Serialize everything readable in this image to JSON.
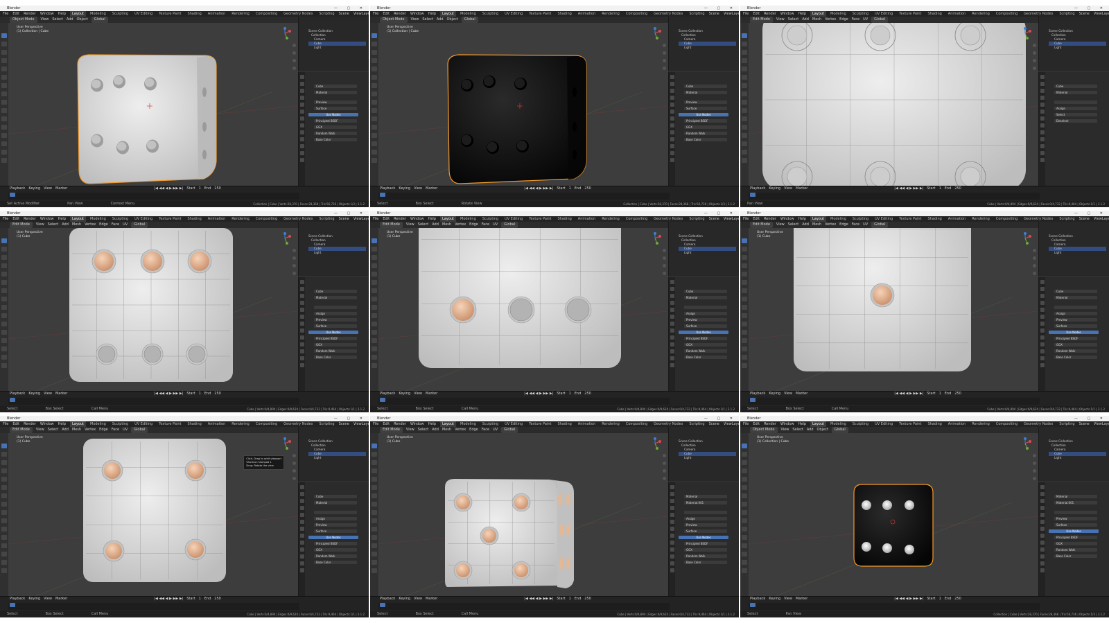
{
  "app": {
    "title": "Blender",
    "window_controls": "— ▢ ✕",
    "menus": [
      "File",
      "Edit",
      "Render",
      "Window",
      "Help"
    ],
    "workspaces": [
      "Layout",
      "Modeling",
      "Sculpting",
      "UV Editing",
      "Texture Paint",
      "Shading",
      "Animation",
      "Rendering",
      "Compositing",
      "Geometry Nodes",
      "Scripting"
    ],
    "active_workspace": "Layout",
    "scene": "Scene",
    "view_layer": "ViewLayer"
  },
  "colors": {
    "viewport_bg": "#3d3d3d",
    "panel_bg": "#2b2b2b",
    "accent_blue": "#4772b3",
    "selection_orange": "#f29a2e",
    "die_white": "#dcdcdc",
    "die_black": "#0b0b0b",
    "pip_skin": "#e7b996"
  },
  "panels": [
    {
      "mode": "Object Mode",
      "header_items": [
        "View",
        "Select",
        "Add",
        "Object"
      ],
      "transform": "Global",
      "vp_line1": "User Perspective",
      "vp_line2": "(1) Collection | Cube",
      "outliner": [
        "Scene Collection",
        "Collection",
        "Camera",
        "Cube",
        "Light"
      ],
      "props_rows": [
        "Cube",
        "Material",
        "Preview",
        "Surface",
        "Use Nodes",
        "Principled BSDF",
        "GGX",
        "Random Walk",
        "Base Color"
      ],
      "timeline": [
        "Playback",
        "Keying",
        "View",
        "Marker"
      ],
      "frames": [
        "Start",
        "1",
        "End",
        "250"
      ],
      "status_left": "Set Active Modifier",
      "status_mid": "Pan View",
      "status_mid2": "Context Menu",
      "status_right": "Collection | Cube | Verts:28,370 | Faces:28,368 | Tris:56,736 | Objects:1/3 | 3.1.2",
      "die": "white-persp",
      "selected": true
    },
    {
      "mode": "Object Mode",
      "header_items": [
        "View",
        "Select",
        "Add",
        "Object"
      ],
      "transform": "Global",
      "vp_line1": "User Perspective",
      "vp_line2": "(1) Collection | Cube",
      "outliner": [
        "Scene Collection",
        "Collection",
        "Camera",
        "Cube",
        "Light"
      ],
      "props_rows": [
        "Cube",
        "Material",
        "Preview",
        "Surface",
        "Use Nodes",
        "Principled BSDF",
        "GGX",
        "Random Walk",
        "Base Color"
      ],
      "timeline": [
        "Playback",
        "Keying",
        "View",
        "Marker"
      ],
      "frames": [
        "Start",
        "1",
        "End",
        "250"
      ],
      "status_left": "Select",
      "status_mid": "Box Select",
      "status_mid2": "Rotate View",
      "status_right": "Collection | Cube | Verts:28,370 | Faces:28,368 | Tris:56,736 | Objects:1/3 | 3.1.2",
      "die": "black-persp",
      "selected": true
    },
    {
      "mode": "Edit Mode",
      "header_items": [
        "View",
        "Select",
        "Add",
        "Mesh",
        "Vertex",
        "Edge",
        "Face",
        "UV"
      ],
      "transform": "Global",
      "vp_line1": "",
      "vp_line2": "",
      "outliner": [
        "Scene Collection",
        "Collection",
        "Camera",
        "Cube",
        "Light"
      ],
      "props_rows": [
        "Cube",
        "Material",
        "",
        "Assign",
        "Select",
        "Deselect"
      ],
      "timeline": [
        "Playback",
        "Keying",
        "View",
        "Marker"
      ],
      "frames": [
        "Start",
        "1",
        "End",
        "250"
      ],
      "status_left": "Pan View",
      "status_mid": "",
      "status_mid2": "",
      "status_right": "Cube | Verts:0/4,894 | Edges:0/9,624 | Faces:0/4,732 | Tris:9,464 | Objects:1/1 | 3.1.2",
      "die": "white-face-close",
      "selected": false
    },
    {
      "mode": "Edit Mode",
      "header_items": [
        "View",
        "Select",
        "Add",
        "Mesh",
        "Vertex",
        "Edge",
        "Face",
        "UV"
      ],
      "transform": "Global",
      "vp_line1": "User Perspective",
      "vp_line2": "(1) Cube",
      "outliner": [
        "Scene Collection",
        "Collection",
        "Camera",
        "Cube",
        "Light"
      ],
      "props_rows": [
        "Cube",
        "Material",
        "",
        "Assign",
        "Preview",
        "Surface",
        "Use Nodes",
        "Principled BSDF",
        "GGX",
        "Random Walk",
        "Base Color"
      ],
      "timeline": [
        "Playback",
        "Keying",
        "View",
        "Marker"
      ],
      "frames": [
        "Start",
        "1",
        "End",
        "250"
      ],
      "status_left": "Select",
      "status_mid": "Box Select",
      "status_mid2": "Call Menu",
      "status_right": "Cube | Verts:0/4,894 | Edges:0/9,624 | Faces:0/4,732 | Tris:9,464 | Objects:1/1 | 3.1.2",
      "die": "white-face-six",
      "selected": false
    },
    {
      "mode": "Edit Mode",
      "header_items": [
        "View",
        "Select",
        "Add",
        "Mesh",
        "Vertex",
        "Edge",
        "Face",
        "UV"
      ],
      "transform": "Global",
      "vp_line1": "User Perspective",
      "vp_line2": "(1) Cube",
      "outliner": [
        "Scene Collection",
        "Collection",
        "Camera",
        "Cube",
        "Light"
      ],
      "props_rows": [
        "Cube",
        "Material",
        "",
        "Assign",
        "Preview",
        "Surface",
        "Use Nodes",
        "Principled BSDF",
        "GGX",
        "Random Walk",
        "Base Color"
      ],
      "timeline": [
        "Playback",
        "Keying",
        "View",
        "Marker"
      ],
      "frames": [
        "Start",
        "1",
        "End",
        "250"
      ],
      "status_left": "Select",
      "status_mid": "Box Select",
      "status_mid2": "Call Menu",
      "status_right": "Cube | Verts:0/4,894 | Edges:0/9,624 | Faces:0/4,732 | Tris:9,464 | Objects:1/1 | 3.1.2",
      "die": "white-face-three",
      "selected": false
    },
    {
      "mode": "Edit Mode",
      "header_items": [
        "View",
        "Select",
        "Add",
        "Mesh",
        "Vertex",
        "Edge",
        "Face",
        "UV"
      ],
      "transform": "Global",
      "vp_line1": "User Perspective",
      "vp_line2": "(1) Cube",
      "outliner": [
        "Scene Collection",
        "Collection",
        "Camera",
        "Cube",
        "Light"
      ],
      "props_rows": [
        "Cube",
        "Material",
        "",
        "Assign",
        "Preview",
        "Surface",
        "Use Nodes",
        "Principled BSDF",
        "GGX",
        "Random Walk",
        "Base Color"
      ],
      "timeline": [
        "Playback",
        "Keying",
        "View",
        "Marker"
      ],
      "frames": [
        "Start",
        "1",
        "End",
        "250"
      ],
      "status_left": "Select",
      "status_mid": "Box Select",
      "status_mid2": "Call Menu",
      "status_right": "Cube | Verts:0/4,894 | Edges:0/9,624 | Faces:0/4,732 | Tris:9,464 | Objects:1/1 | 3.1.2",
      "die": "white-face-one",
      "selected": false
    },
    {
      "mode": "Edit Mode",
      "header_items": [
        "View",
        "Select",
        "Add",
        "Mesh",
        "Vertex",
        "Edge",
        "Face",
        "UV"
      ],
      "transform": "Global",
      "vp_line1": "User Perspective",
      "vp_line2": "(1) Cube",
      "outliner": [
        "Scene Collection",
        "Collection",
        "Camera",
        "Cube",
        "Light"
      ],
      "props_rows": [
        "Cube",
        "Material",
        "",
        "Assign",
        "Preview",
        "Surface",
        "Use Nodes",
        "Principled BSDF",
        "GGX",
        "Random Walk",
        "Base Color"
      ],
      "timeline": [
        "Playback",
        "Keying",
        "View",
        "Marker"
      ],
      "frames": [
        "Start",
        "1",
        "End",
        "250"
      ],
      "status_left": "Select",
      "status_mid": "Box Select",
      "status_mid2": "Call Menu",
      "status_right": "Cube | Verts:0/4,894 | Edges:0/9,624 | Faces:0/4,732 | Tris:9,464 | Objects:1/1 | 3.1.2",
      "die": "white-face-four",
      "selected": false,
      "tooltip": [
        "Click, Drag to orbit viewport",
        "Shortcut: Numpad 1",
        "Drag: Rotate the view"
      ]
    },
    {
      "mode": "Edit Mode",
      "header_items": [
        "View",
        "Select",
        "Add",
        "Mesh",
        "Vertex",
        "Edge",
        "Face",
        "UV"
      ],
      "transform": "Global",
      "vp_line1": "User Perspective",
      "vp_line2": "(1) Cube",
      "outliner": [
        "Scene Collection",
        "Collection",
        "Camera",
        "Cube",
        "Light"
      ],
      "props_rows": [
        "Material",
        "Material.001",
        "",
        "Assign",
        "Preview",
        "Surface",
        "Use Nodes",
        "Principled BSDF",
        "GGX",
        "Random Walk",
        "Base Color"
      ],
      "timeline": [
        "Playback",
        "Keying",
        "View",
        "Marker"
      ],
      "frames": [
        "Start",
        "1",
        "End",
        "250"
      ],
      "status_left": "Select",
      "status_mid": "Box Select",
      "status_mid2": "Call Menu",
      "status_right": "Cube | Verts:0/4,894 | Edges:0/9,624 | Faces:0/4,732 | Tris:9,464 | Objects:1/1 | 3.1.2",
      "die": "white-persp-five",
      "selected": false
    },
    {
      "mode": "Object Mode",
      "header_items": [
        "View",
        "Select",
        "Add",
        "Object"
      ],
      "transform": "Global",
      "vp_line1": "User Perspective",
      "vp_line2": "(1) Collection | Cube",
      "outliner": [
        "Scene Collection",
        "Collection",
        "Camera",
        "Cube",
        "Light"
      ],
      "props_rows": [
        "Material",
        "Material.001",
        "",
        "Preview",
        "Surface",
        "Use Nodes",
        "Principled BSDF",
        "GGX",
        "Random Walk",
        "Base Color"
      ],
      "timeline": [
        "Playback",
        "Keying",
        "View",
        "Marker"
      ],
      "frames": [
        "Start",
        "1",
        "End",
        "250"
      ],
      "status_left": "Select",
      "status_mid": "Pan View",
      "status_mid2": "",
      "status_right": "Collection | Cube | Verts:28,370 | Faces:28,368 | Tris:56,736 | Objects:1/3 | 3.1.2",
      "die": "black-front-six",
      "selected": true
    }
  ]
}
